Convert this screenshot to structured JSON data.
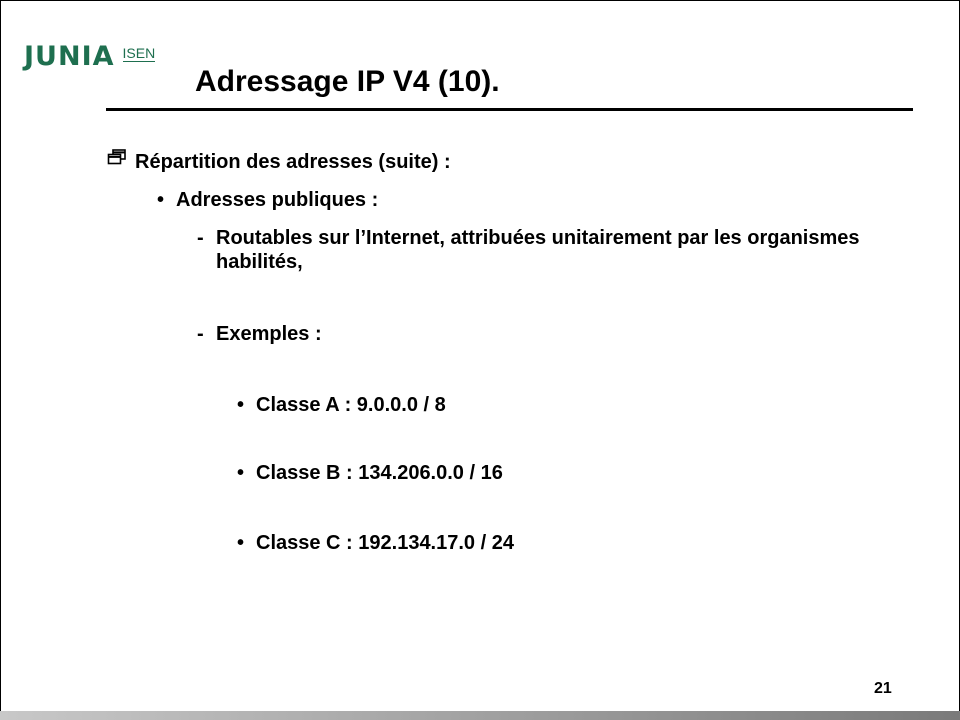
{
  "logo": {
    "brand": "JUNIA",
    "sub": "ISEN",
    "color": "#1e6f4f"
  },
  "slide": {
    "title": "Adressage IP V4 (10).",
    "level1": {
      "icon": "window-restore-icon",
      "text": "Répartition des adresses (suite) :"
    },
    "level2": {
      "bullet": "•",
      "text": "Adresses publiques :"
    },
    "dash_items": [
      {
        "marker": "-",
        "text": "Routables sur l’Internet, attribuées unitairement par les organismes habilités,"
      },
      {
        "marker": "-",
        "text": "Exemples :"
      }
    ],
    "examples": [
      {
        "bullet": "•",
        "text": "Classe A : 9.0.0.0  / 8"
      },
      {
        "bullet": "•",
        "text": "Classe B : 134.206.0.0  / 16"
      },
      {
        "bullet": "•",
        "text": "Classe C : 192.134.17.0  / 24"
      }
    ],
    "page_number": "21"
  },
  "colors": {
    "footer_gradient_start": "#c8c8c8",
    "footer_gradient_end": "#7a7a7a"
  }
}
